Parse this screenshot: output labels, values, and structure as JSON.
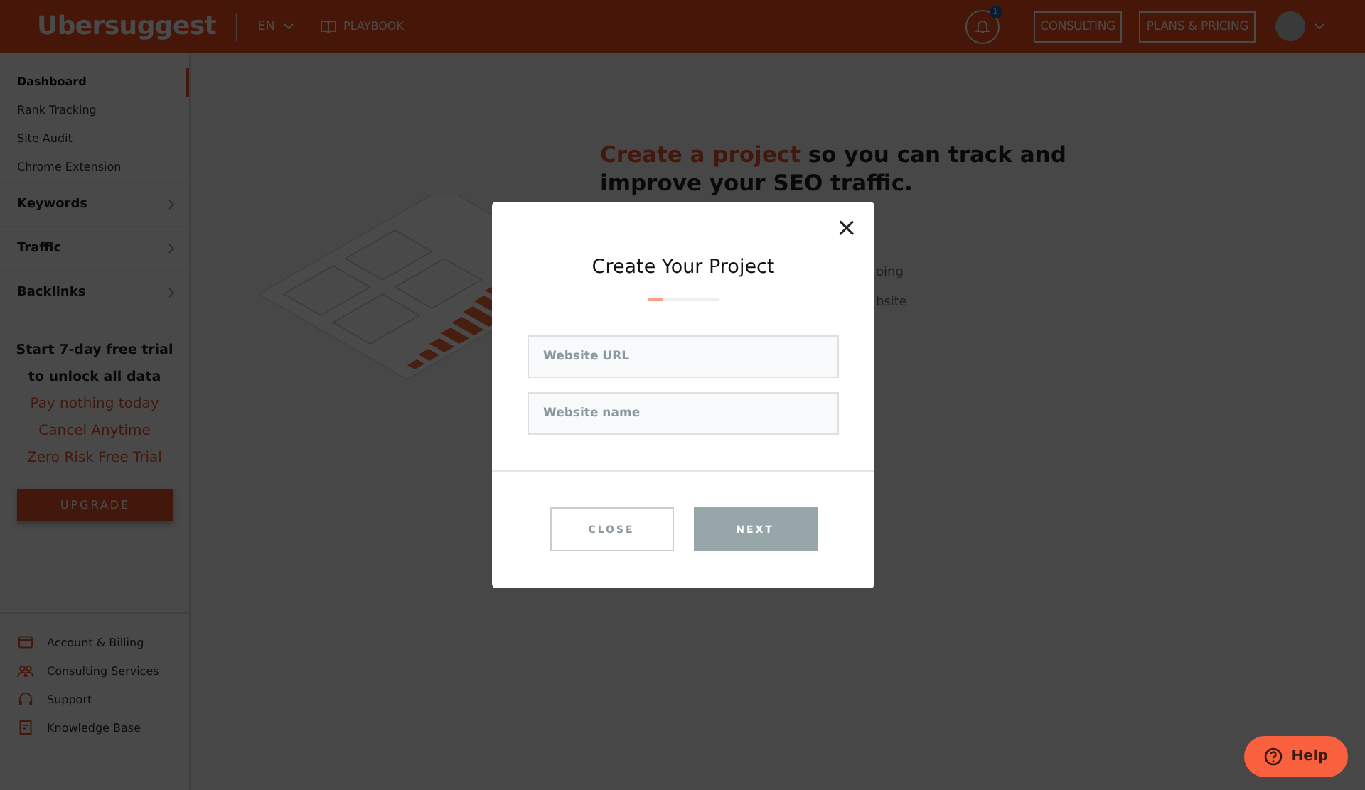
{
  "header": {
    "logo": "Ubersuggest",
    "language": "EN",
    "playbook": "PLAYBOOK",
    "notification_count": "1",
    "buttons": [
      "CONSULTING",
      "PLANS & PRICING"
    ]
  },
  "sidebar": {
    "items": [
      {
        "label": "Dashboard",
        "selected": true
      },
      {
        "label": "Rank Tracking",
        "selected": false
      },
      {
        "label": "Site Audit",
        "selected": false
      },
      {
        "label": "Chrome Extension",
        "selected": false
      }
    ],
    "sections": [
      "Keywords",
      "Traffic",
      "Backlinks"
    ],
    "trial": {
      "title": "Start 7-day free trial to unlock all data",
      "perks": [
        "Pay nothing today",
        "Cancel Anytime",
        "Zero Risk Free Trial"
      ],
      "button": "UPGRADE"
    },
    "footer_links": [
      {
        "kind": "card",
        "label": "Account & Billing"
      },
      {
        "kind": "people",
        "label": "Consulting Services"
      },
      {
        "kind": "headset",
        "label": "Support"
      },
      {
        "kind": "doc",
        "label": "Knowledge Base"
      }
    ]
  },
  "hero": {
    "highlight": "Create a project",
    "heading": "so you can track and improve your SEO traffic.",
    "bullets": [
      "oing",
      "bsite"
    ]
  },
  "modal": {
    "title": "Create Your Project",
    "progress": {
      "level": 0.2
    },
    "fields": [
      {
        "placeholder": "Website URL"
      },
      {
        "placeholder": "Website name"
      }
    ],
    "close": "CLOSE",
    "next": "NEXT",
    "close_icon": "×"
  },
  "help": "Help"
}
